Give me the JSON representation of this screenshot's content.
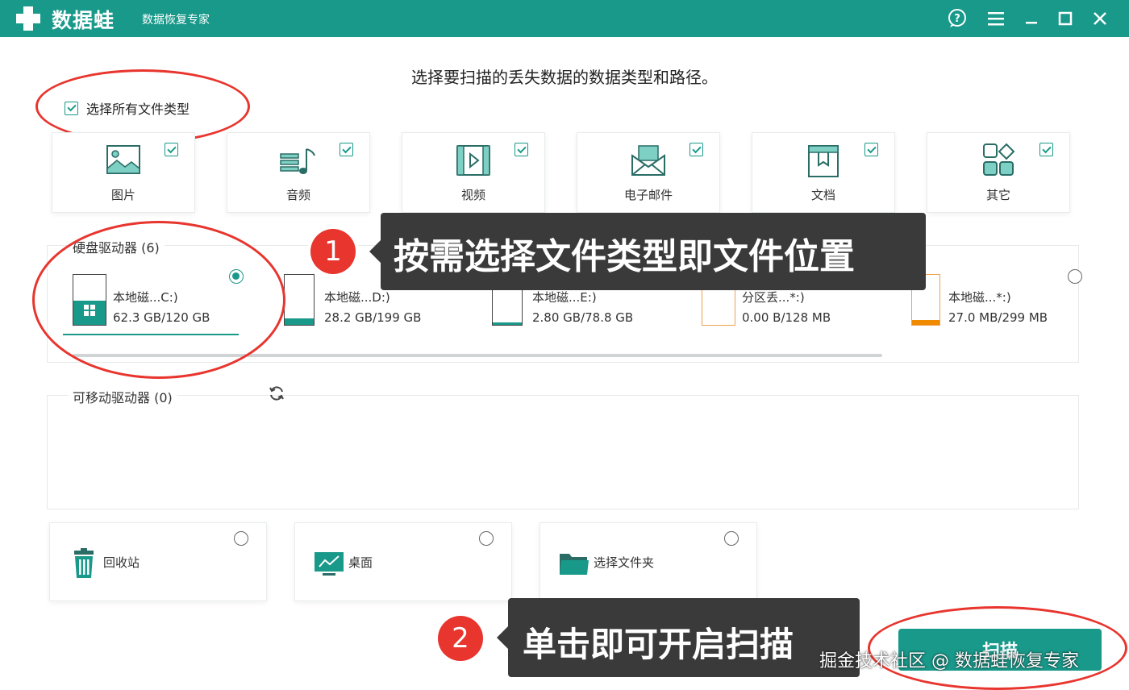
{
  "app": {
    "name": "数据蛙",
    "subtitle": "数据恢复专家"
  },
  "heading": "选择要扫描的丢失数据的数据类型和路径。",
  "select_all": {
    "label": "选择所有文件类型",
    "checked": true
  },
  "file_types": [
    {
      "label": "图片",
      "icon": "image-icon",
      "checked": true
    },
    {
      "label": "音频",
      "icon": "music-icon",
      "checked": true
    },
    {
      "label": "视频",
      "icon": "video-icon",
      "checked": true
    },
    {
      "label": "电子邮件",
      "icon": "mail-icon",
      "checked": true
    },
    {
      "label": "文档",
      "icon": "document-icon",
      "checked": true
    },
    {
      "label": "其它",
      "icon": "other-icon",
      "checked": true
    }
  ],
  "hard_drives": {
    "label": "硬盘驱动器 (6)",
    "items": [
      {
        "name": "本地磁...C:)",
        "size": "62.3 GB/120 GB",
        "selected": true,
        "fill_color": "#18998a"
      },
      {
        "name": "本地磁...D:)",
        "size": "28.2 GB/199 GB",
        "selected": false,
        "fill_color": "#18998a"
      },
      {
        "name": "本地磁...E:)",
        "size": "2.80 GB/78.8 GB",
        "selected": false,
        "fill_color": "#18998a"
      },
      {
        "name": "分区丢...*:)",
        "size": "0.00  B/128 MB",
        "selected": false,
        "fill_color": "#f0a050"
      },
      {
        "name": "本地磁...*:)",
        "size": "27.0 MB/299 MB",
        "selected": false,
        "fill_color": "#f08a00"
      }
    ]
  },
  "removable": {
    "label": "可移动驱动器 (0)"
  },
  "locations": [
    {
      "label": "回收站",
      "icon": "trash-icon"
    },
    {
      "label": "桌面",
      "icon": "desktop-icon"
    },
    {
      "label": "选择文件夹",
      "icon": "folder-icon"
    }
  ],
  "annotations": {
    "step1_number": "1",
    "step1_text": "按需选择文件类型即文件位置",
    "step2_number": "2",
    "step2_text": "单击即可开启扫描"
  },
  "scan_button": "扫描",
  "watermark": "掘金技术社区 @ 数据蛙恢复专家",
  "colors": {
    "accent": "#18998a",
    "annotation_red": "#e8352e",
    "callout_bg": "#3a3a3a"
  }
}
